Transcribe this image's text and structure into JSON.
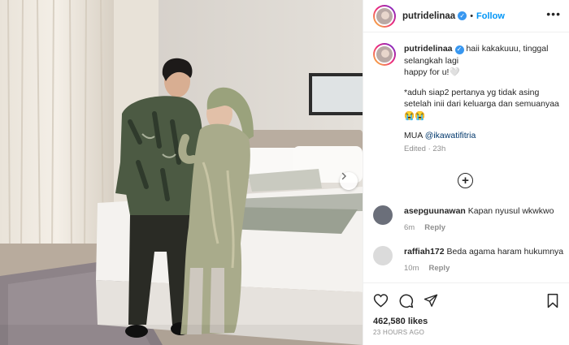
{
  "post": {
    "username": "putridelinaa",
    "follow_label": "Follow",
    "separator": "•",
    "more_glyph": "•••",
    "caption": {
      "username": "putridelinaa",
      "line1": "haii kakakuuu, tinggal selangkah lagi",
      "line2": "happy for u!🤍",
      "para2": "*aduh siap2 pertanya yg tidak asing setelah inii dari keluarga dan semuanyaa 😭😭",
      "mua_label": "MUA",
      "mua_mention": "@ikawatifitria",
      "edited": "Edited",
      "edited_time": "23h"
    },
    "comments": [
      {
        "username": "asepguunawan",
        "text": "Kapan nyusul wkwkwo",
        "time": "6m",
        "reply": "Reply"
      },
      {
        "username": "raffiah172",
        "text": "Beda agama haram hukumnya",
        "time": "10m",
        "reply": "Reply"
      }
    ],
    "likes": "462,580 likes",
    "posted": "23 HOURS AGO"
  },
  "icons": {
    "verified": "verified-badge",
    "like": "heart-icon",
    "comment": "comment-icon",
    "share": "share-icon",
    "save": "bookmark-icon",
    "add": "plus-circle-icon",
    "next": "chevron-right-icon"
  },
  "colors": {
    "accent": "#0095f6",
    "verified": "#3897f0",
    "muted": "#8e8e8e",
    "text": "#262626"
  }
}
